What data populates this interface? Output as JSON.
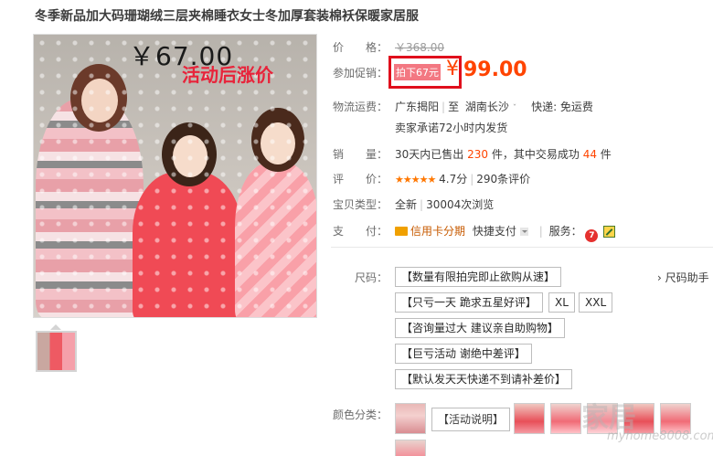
{
  "product": {
    "title": "冬季新品加大码珊瑚绒三层夹棉睡衣女士冬加厚套装棉袄保暖家居服"
  },
  "image": {
    "price_overlay": "￥67.00",
    "promo_overlay": "活动后涨价"
  },
  "rows": {
    "price_label": "价　　格：",
    "price_original": "￥368.00",
    "promo_label": "参加促销：",
    "promo_tag": "拍下67元",
    "currency": "¥",
    "promo_price": "99.00",
    "shipping_label": "物流运费：",
    "shipping_from": "广东揭阳",
    "shipping_to_prefix": "至",
    "shipping_to": "湖南长沙",
    "shipping_fee": "快递: 免运费",
    "shipping_promise": "卖家承诺72小时内发货",
    "sales_label": "销　　量：",
    "sales_prefix": "30天内已售出",
    "sales_count": "230",
    "sales_mid": "件，其中交易成功",
    "sales_success": "44",
    "sales_suffix": "件",
    "rating_label": "评　　价：",
    "rating_stars": "★★★★★",
    "rating_score": "4.7分",
    "rating_count": "290条评价",
    "type_label": "宝贝类型：",
    "type_value": "全新",
    "views": "30004次浏览",
    "pay_label": "支　　付：",
    "pay_credit": "信用卡分期",
    "pay_quick": "快捷支付",
    "service_label": "服务：",
    "service_icon1": "7"
  },
  "sizes": {
    "label": "尺码：",
    "options": [
      "【数量有限拍完即止欲购从速】",
      "【只亏一天 跪求五星好评】",
      "XL",
      "XXL",
      "【咨询量过大 建议亲自助购物】",
      "【巨亏活动 谢绝中差评】",
      "【默认发天天快递不到请补差价】"
    ],
    "helper": "› 尺码助手"
  },
  "colors": {
    "label": "颜色分类：",
    "text_option": "【活动说明】"
  },
  "watermark": {
    "text": "家居",
    "url": "myhome8008.com"
  },
  "colors_palette": {
    "accent": "#ff4400",
    "highlight_box": "#e00f1c"
  }
}
